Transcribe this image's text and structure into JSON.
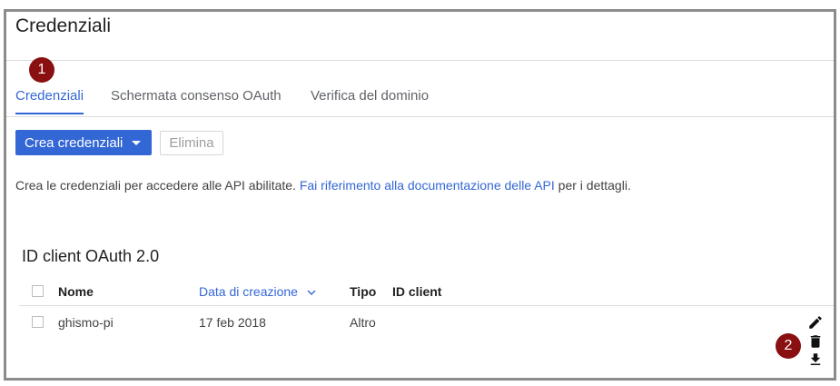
{
  "page": {
    "title": "Credenziali"
  },
  "markers": [
    "1",
    "2"
  ],
  "tabs": [
    {
      "label": "Credenziali",
      "active": true
    },
    {
      "label": "Schermata consenso OAuth",
      "active": false
    },
    {
      "label": "Verifica del dominio",
      "active": false
    }
  ],
  "toolbar": {
    "create_label": "Crea credenziali",
    "delete_label": "Elimina"
  },
  "description": {
    "before": "Crea le credenziali per accedere alle API abilitate. ",
    "link": "Fai riferimento alla documentazione delle API",
    "after": " per i dettagli."
  },
  "oauth_section": {
    "title": "ID client OAuth 2.0",
    "columns": {
      "name": "Nome",
      "created": "Data di creazione",
      "type": "Tipo",
      "client_id": "ID client"
    },
    "rows": [
      {
        "name": "ghismo-pi",
        "created": "17 feb 2018",
        "type": "Altro",
        "client_id": ""
      }
    ]
  },
  "icons": [
    "edit-icon",
    "delete-icon",
    "download-icon",
    "sort-descending-icon"
  ],
  "colors": {
    "accent": "#3367d6",
    "marker": "#8a0f10",
    "frame": "#8c8c8c"
  }
}
